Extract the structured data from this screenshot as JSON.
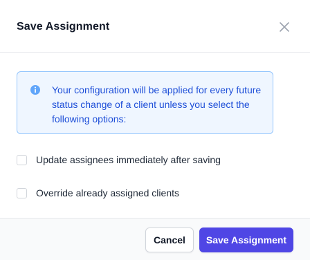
{
  "dialog": {
    "title": "Save Assignment",
    "close_icon": "close-icon"
  },
  "info": {
    "icon": "info-icon",
    "message": "Your configuration will be applied for every future status change of a client unless you select the following options:"
  },
  "options": [
    {
      "label": "Update assignees immediately after saving",
      "checked": false
    },
    {
      "label": "Override already assigned clients",
      "checked": false
    }
  ],
  "footer": {
    "cancel_label": "Cancel",
    "save_label": "Save Assignment"
  },
  "colors": {
    "primary": "#4f46e5",
    "info_bg": "#eff6ff",
    "info_border": "#93c5fd",
    "info_text": "#1d4ed8"
  }
}
